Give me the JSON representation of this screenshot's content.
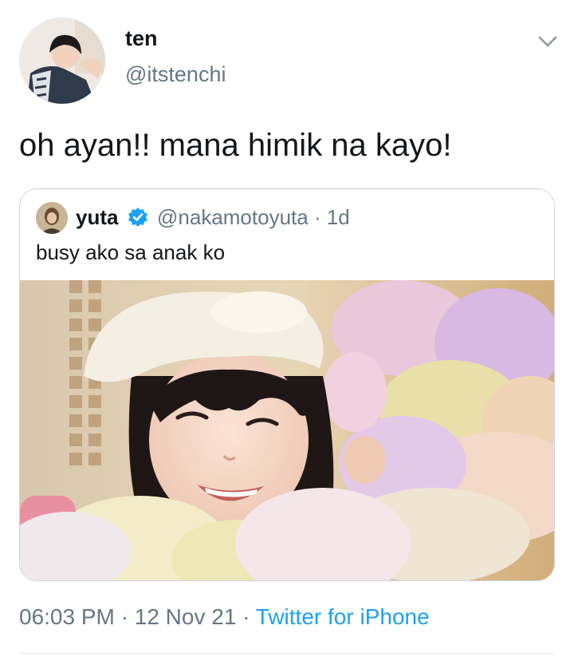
{
  "tweet": {
    "author_name": "ten",
    "author_handle": "@itstenchi",
    "text": "oh ayan!! mana himik na kayo!",
    "time": "06:03 PM",
    "date": "12 Nov 21",
    "source": "Twitter for iPhone",
    "separator": " · "
  },
  "quote": {
    "author_name": "yuta",
    "author_handle": "@nakamotoyuta",
    "age": "1d",
    "handle_age": "@nakamotoyuta · 1d",
    "text": "busy ako sa anak ko",
    "verified": true
  },
  "icons": {
    "more": "chevron-down-icon",
    "verified": "verified-badge-icon"
  },
  "colors": {
    "text": "#14171a",
    "secondary": "#657786",
    "link": "#1da1f2",
    "border": "#ccd6dd"
  }
}
